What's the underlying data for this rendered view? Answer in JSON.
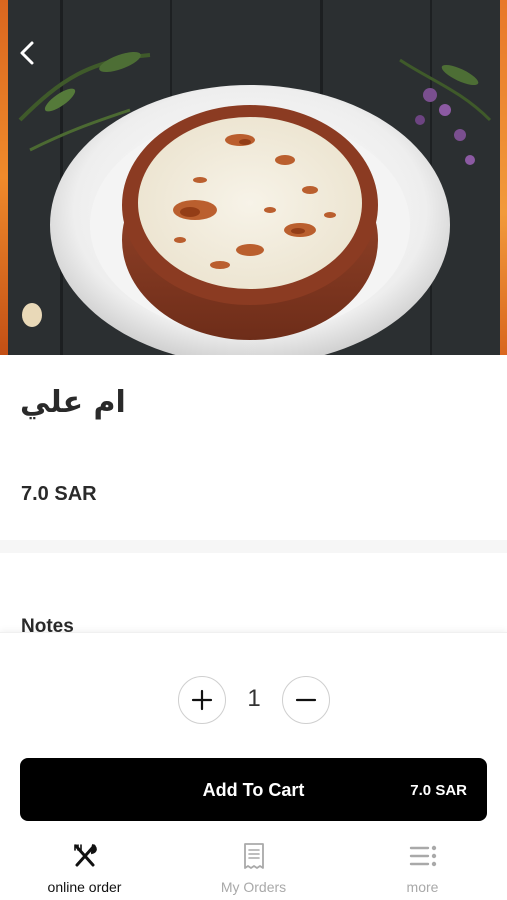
{
  "item": {
    "name": "ام علي",
    "price": "7.0 SAR"
  },
  "notes": {
    "label": "Notes"
  },
  "quantity": {
    "value": "1"
  },
  "cart": {
    "button_label": "Add To Cart",
    "total": "7.0 SAR"
  },
  "tabs": [
    {
      "label": "online order",
      "icon": "fork-knife-icon",
      "active": true
    },
    {
      "label": "My Orders",
      "icon": "receipt-icon",
      "active": false
    },
    {
      "label": "more",
      "icon": "menu-dots-icon",
      "active": false
    }
  ],
  "colors": {
    "primary": "#000000",
    "inactive_tab": "#a9a9a9",
    "accent_edge": "#f08a2b"
  }
}
